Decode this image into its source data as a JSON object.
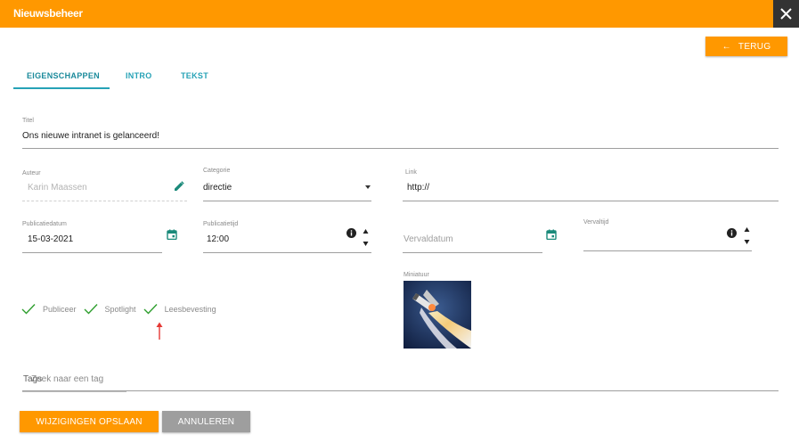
{
  "window": {
    "title": "Nieuwsbeheer"
  },
  "toolbar": {
    "back_label": "TERUG",
    "back_arrow": "←"
  },
  "tabs": [
    {
      "label": "EIGENSCHAPPEN",
      "active": true
    },
    {
      "label": "INTRO",
      "active": false
    },
    {
      "label": "TEKST",
      "active": false
    }
  ],
  "fields": {
    "titel": {
      "label": "Titel",
      "value": "Ons nieuwe intranet is gelanceerd!"
    },
    "auteur": {
      "label": "Auteur",
      "value": "Karin Maassen"
    },
    "categorie": {
      "label": "Categorie",
      "value": "directie"
    },
    "link": {
      "label": "Link",
      "value": "http://"
    },
    "publicatiedatum": {
      "label": "Publicatiedatum",
      "value": "15-03-2021"
    },
    "publicatietijd": {
      "label": "Publicatietijd",
      "value": "12:00"
    },
    "vervaldatum": {
      "label": "",
      "placeholder": "Vervaldatum",
      "value": ""
    },
    "vervaltijd": {
      "label": "Vervaltijd",
      "value": ""
    },
    "miniatuur": {
      "label": "Miniatuur"
    },
    "tags": {
      "placeholder": "Zoek naar een tag",
      "overlay_text": "Tags"
    }
  },
  "checkboxes": [
    {
      "label": "Publiceer",
      "checked": true
    },
    {
      "label": "Spotlight",
      "checked": true
    },
    {
      "label": "Leesbevesting",
      "checked": true
    }
  ],
  "actions": {
    "save_label": "WIJZIGINGEN OPSLAAN",
    "cancel_label": "ANNULEREN"
  },
  "colors": {
    "accent": "#ff9800",
    "tab": "#26a2b6",
    "check": "#2e9e2e",
    "annotation_arrow": "#e53935",
    "cancel": "#9e9e9e"
  },
  "icons": [
    "close-icon",
    "arrow-left-icon",
    "pencil-icon",
    "dropdown-arrow-icon",
    "calendar-icon",
    "info-icon",
    "stepper-icon",
    "check-icon",
    "annotation-arrow-icon"
  ]
}
